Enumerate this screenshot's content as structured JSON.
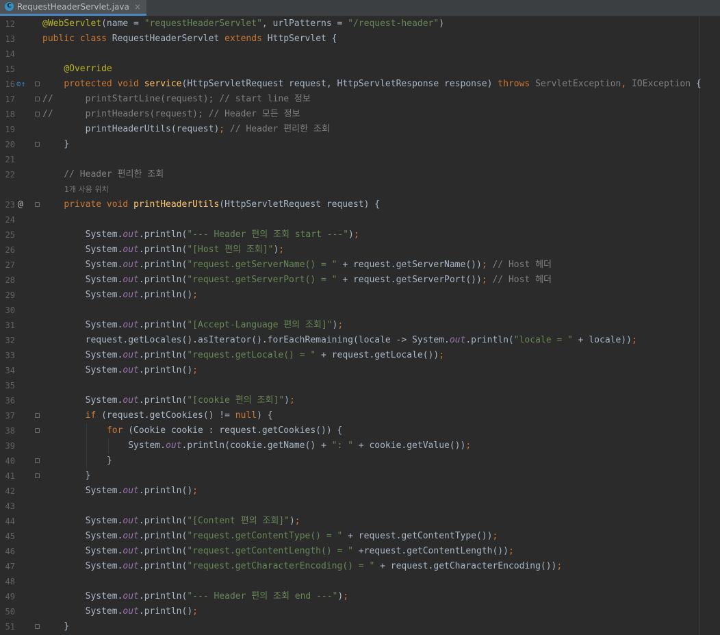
{
  "tab": {
    "label": "RequestHeaderServlet.java",
    "close": "×",
    "icon": "C"
  },
  "hint": "1개 사용 위치",
  "lines": [
    {
      "n": "12",
      "tokens": [
        [
          "an",
          "@WebServlet"
        ],
        [
          "",
          "(name = "
        ],
        [
          "st",
          "\"requestHeaderServlet\""
        ],
        [
          "",
          ", urlPatterns = "
        ],
        [
          "st",
          "\"/request-header\""
        ],
        [
          "",
          ")"
        ]
      ]
    },
    {
      "n": "13",
      "tokens": [
        [
          "kw",
          "public class "
        ],
        [
          "",
          "RequestHeaderServlet "
        ],
        [
          "kw",
          "extends "
        ],
        [
          "",
          "HttpServlet {"
        ]
      ]
    },
    {
      "n": "14",
      "tokens": []
    },
    {
      "n": "15",
      "tokens": [
        [
          "",
          "    "
        ],
        [
          "an",
          "@Override"
        ]
      ]
    },
    {
      "n": "16",
      "tokens": [
        [
          "",
          "    "
        ],
        [
          "kw",
          "protected void "
        ],
        [
          "fn",
          "service"
        ],
        [
          "",
          "(HttpServletRequest request, HttpServletResponse response) "
        ],
        [
          "kw",
          "throws "
        ],
        [
          "muted",
          "ServletException"
        ],
        [
          "kw",
          ", "
        ],
        [
          "muted",
          "IOException"
        ],
        [
          "",
          " {"
        ]
      ]
    },
    {
      "n": "17",
      "tokens": [
        [
          "cm",
          "//      printStartLine(request); // start line 정보"
        ]
      ]
    },
    {
      "n": "18",
      "tokens": [
        [
          "cm",
          "//      printHeaders(request); // Header 모든 정보"
        ]
      ]
    },
    {
      "n": "19",
      "tokens": [
        [
          "",
          "        printHeaderUtils(request)"
        ],
        [
          "kw",
          ";"
        ],
        [
          "cm",
          " // Header 편리한 조회"
        ]
      ]
    },
    {
      "n": "20",
      "tokens": [
        [
          "",
          "    }"
        ]
      ]
    },
    {
      "n": "21",
      "tokens": []
    },
    {
      "n": "22",
      "tokens": [
        [
          "cm",
          "    // Header 편리한 조회"
        ]
      ]
    },
    {
      "n": "",
      "tokens": [],
      "hint": true
    },
    {
      "n": "23",
      "tokens": [
        [
          "",
          "    "
        ],
        [
          "kw",
          "private void "
        ],
        [
          "fn",
          "printHeaderUtils"
        ],
        [
          "",
          "(HttpServletRequest request) {"
        ]
      ]
    },
    {
      "n": "24",
      "tokens": []
    },
    {
      "n": "25",
      "tokens": [
        [
          "",
          "        System."
        ],
        [
          "st-f",
          "out"
        ],
        [
          "",
          ".println("
        ],
        [
          "st",
          "\"--- Header 편의 조회 start ---\""
        ],
        [
          "",
          ")"
        ],
        [
          "kw",
          ";"
        ]
      ]
    },
    {
      "n": "26",
      "tokens": [
        [
          "",
          "        System."
        ],
        [
          "st-f",
          "out"
        ],
        [
          "",
          ".println("
        ],
        [
          "st",
          "\"[Host 편의 조회]\""
        ],
        [
          "",
          ")"
        ],
        [
          "kw",
          ";"
        ]
      ]
    },
    {
      "n": "27",
      "tokens": [
        [
          "",
          "        System."
        ],
        [
          "st-f",
          "out"
        ],
        [
          "",
          ".println("
        ],
        [
          "st",
          "\"request.getServerName() = \""
        ],
        [
          "",
          " + request.getServerName())"
        ],
        [
          "kw",
          ";"
        ],
        [
          "cm",
          " // Host 헤더"
        ]
      ]
    },
    {
      "n": "28",
      "tokens": [
        [
          "",
          "        System."
        ],
        [
          "st-f",
          "out"
        ],
        [
          "",
          ".println("
        ],
        [
          "st",
          "\"request.getServerPort() = \""
        ],
        [
          "",
          " + request.getServerPort())"
        ],
        [
          "kw",
          ";"
        ],
        [
          "cm",
          " // Host 헤더"
        ]
      ]
    },
    {
      "n": "29",
      "tokens": [
        [
          "",
          "        System."
        ],
        [
          "st-f",
          "out"
        ],
        [
          "",
          ".println()"
        ],
        [
          "kw",
          ";"
        ]
      ]
    },
    {
      "n": "30",
      "tokens": []
    },
    {
      "n": "31",
      "tokens": [
        [
          "",
          "        System."
        ],
        [
          "st-f",
          "out"
        ],
        [
          "",
          ".println("
        ],
        [
          "st",
          "\"[Accept-Language 편의 조회]\""
        ],
        [
          "",
          ")"
        ],
        [
          "kw",
          ";"
        ]
      ]
    },
    {
      "n": "32",
      "tokens": [
        [
          "",
          "        request.getLocales().asIterator().forEachRemaining(locale -> System."
        ],
        [
          "st-f",
          "out"
        ],
        [
          "",
          ".println("
        ],
        [
          "st",
          "\"locale = \""
        ],
        [
          "",
          " + locale))"
        ],
        [
          "kw",
          ";"
        ]
      ]
    },
    {
      "n": "33",
      "tokens": [
        [
          "",
          "        System."
        ],
        [
          "st-f",
          "out"
        ],
        [
          "",
          ".println("
        ],
        [
          "st",
          "\"request.getLocale() = \""
        ],
        [
          "",
          " + request.getLocale())"
        ],
        [
          "kw",
          ";"
        ]
      ]
    },
    {
      "n": "34",
      "tokens": [
        [
          "",
          "        System."
        ],
        [
          "st-f",
          "out"
        ],
        [
          "",
          ".println()"
        ],
        [
          "kw",
          ";"
        ]
      ]
    },
    {
      "n": "35",
      "tokens": []
    },
    {
      "n": "36",
      "tokens": [
        [
          "",
          "        System."
        ],
        [
          "st-f",
          "out"
        ],
        [
          "",
          ".println("
        ],
        [
          "st",
          "\"[cookie 편의 조회]\""
        ],
        [
          "",
          ")"
        ],
        [
          "kw",
          ";"
        ]
      ]
    },
    {
      "n": "37",
      "tokens": [
        [
          "",
          "        "
        ],
        [
          "kw",
          "if "
        ],
        [
          "",
          "(request.getCookies() != "
        ],
        [
          "kw",
          "null"
        ],
        [
          "",
          ") {"
        ]
      ]
    },
    {
      "n": "38",
      "tokens": [
        [
          "",
          "            "
        ],
        [
          "kw",
          "for "
        ],
        [
          "",
          "(Cookie cookie : request.getCookies()) {"
        ]
      ]
    },
    {
      "n": "39",
      "tokens": [
        [
          "",
          "                System."
        ],
        [
          "st-f",
          "out"
        ],
        [
          "",
          ".println(cookie.getName() + "
        ],
        [
          "st",
          "\": \""
        ],
        [
          "",
          " + cookie.getValue())"
        ],
        [
          "kw",
          ";"
        ]
      ]
    },
    {
      "n": "40",
      "tokens": [
        [
          "",
          "            }"
        ]
      ]
    },
    {
      "n": "41",
      "tokens": [
        [
          "",
          "        }"
        ]
      ]
    },
    {
      "n": "42",
      "tokens": [
        [
          "",
          "        System."
        ],
        [
          "st-f",
          "out"
        ],
        [
          "",
          ".println()"
        ],
        [
          "kw",
          ";"
        ]
      ]
    },
    {
      "n": "43",
      "tokens": []
    },
    {
      "n": "44",
      "tokens": [
        [
          "",
          "        System."
        ],
        [
          "st-f",
          "out"
        ],
        [
          "",
          ".println("
        ],
        [
          "st",
          "\"[Content 편의 조회]\""
        ],
        [
          "",
          ")"
        ],
        [
          "kw",
          ";"
        ]
      ]
    },
    {
      "n": "45",
      "tokens": [
        [
          "",
          "        System."
        ],
        [
          "st-f",
          "out"
        ],
        [
          "",
          ".println("
        ],
        [
          "st",
          "\"request.getContentType() = \""
        ],
        [
          "",
          " + request.getContentType())"
        ],
        [
          "kw",
          ";"
        ]
      ]
    },
    {
      "n": "46",
      "tokens": [
        [
          "",
          "        System."
        ],
        [
          "st-f",
          "out"
        ],
        [
          "",
          ".println("
        ],
        [
          "st",
          "\"request.getContentLength() = \""
        ],
        [
          "",
          " +request.getContentLength())"
        ],
        [
          "kw",
          ";"
        ]
      ]
    },
    {
      "n": "47",
      "tokens": [
        [
          "",
          "        System."
        ],
        [
          "st-f",
          "out"
        ],
        [
          "",
          ".println("
        ],
        [
          "st",
          "\"request.getCharacterEncoding() = \""
        ],
        [
          "",
          " + request.getCharacterEncoding())"
        ],
        [
          "kw",
          ";"
        ]
      ]
    },
    {
      "n": "48",
      "tokens": []
    },
    {
      "n": "49",
      "tokens": [
        [
          "",
          "        System."
        ],
        [
          "st-f",
          "out"
        ],
        [
          "",
          ".println("
        ],
        [
          "st",
          "\"--- Header 편의 조회 end ---\""
        ],
        [
          "",
          ")"
        ],
        [
          "kw",
          ";"
        ]
      ]
    },
    {
      "n": "50",
      "tokens": [
        [
          "",
          "        System."
        ],
        [
          "st-f",
          "out"
        ],
        [
          "",
          ".println()"
        ],
        [
          "kw",
          ";"
        ]
      ]
    },
    {
      "n": "51",
      "tokens": [
        [
          "",
          "    }"
        ]
      ]
    }
  ]
}
